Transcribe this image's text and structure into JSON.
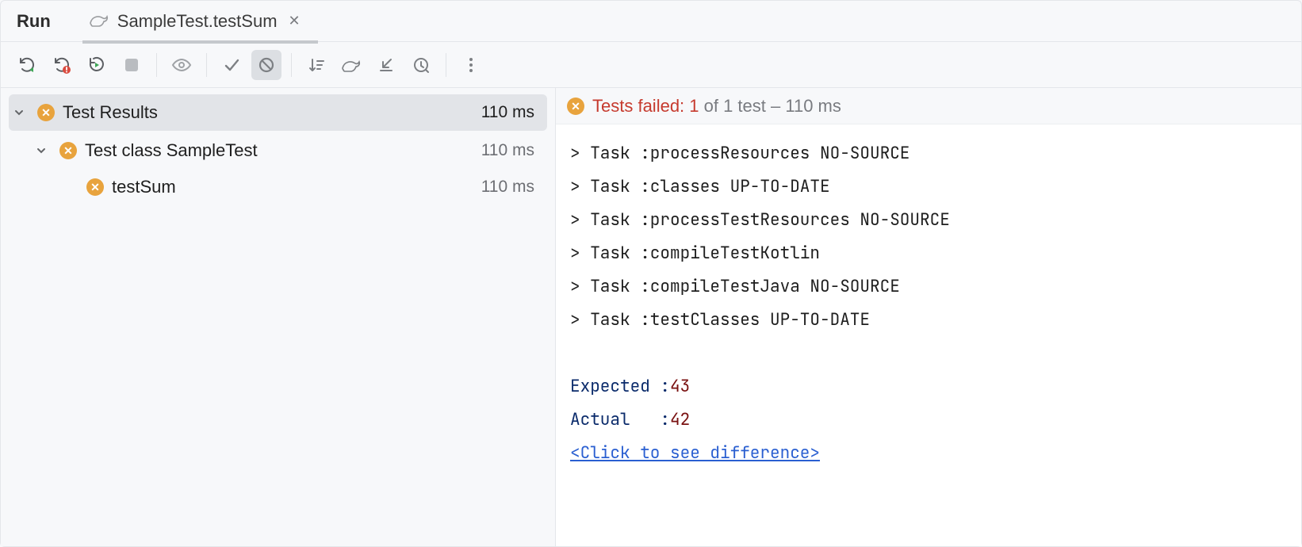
{
  "header": {
    "run_label": "Run",
    "tab_title": "SampleTest.testSum"
  },
  "tree": {
    "root": {
      "label": "Test Results",
      "time": "110 ms"
    },
    "class": {
      "label": "Test class SampleTest",
      "time": "110 ms"
    },
    "test": {
      "label": "testSum",
      "time": "110 ms"
    }
  },
  "summary": {
    "failed_label": "Tests failed: 1",
    "rest": " of 1 test – 110 ms"
  },
  "console": {
    "lines": [
      "> Task :processResources NO-SOURCE",
      "> Task :classes UP-TO-DATE",
      "> Task :processTestResources NO-SOURCE",
      "> Task :compileTestKotlin",
      "> Task :compileTestJava NO-SOURCE",
      "> Task :testClasses UP-TO-DATE"
    ],
    "expected_label": "Expected :",
    "expected_value": "43",
    "actual_label": "Actual   :",
    "actual_value": "42",
    "diff_link": "<Click to see difference>"
  }
}
